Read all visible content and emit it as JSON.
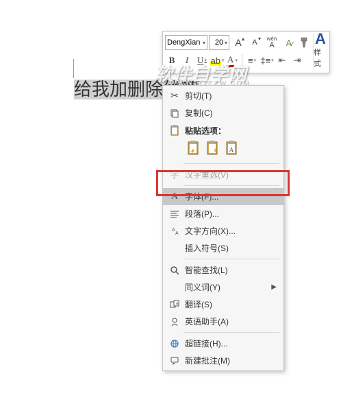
{
  "document": {
    "selected_text": "给我加删除线吧"
  },
  "toolbar": {
    "font_name": "DengXian",
    "font_size": "20",
    "style_label": "样式"
  },
  "watermark": {
    "main": "软件自学网",
    "sub": "WWW.RJZXW.COM"
  },
  "menu": {
    "cut": "剪切(T)",
    "copy": "复制(C)",
    "paste_options": "粘贴选项：",
    "han_reselect": "汉字重选(V)",
    "font": "字体(F)...",
    "paragraph": "段落(P)...",
    "text_direction": "文字方向(X)...",
    "insert_symbol": "插入符号(S)",
    "smart_lookup": "智能查找(L)",
    "synonyms": "同义词(Y)",
    "translate": "翻译(S)",
    "english_assistant": "英语助手(A)",
    "hyperlink": "超链接(H)...",
    "new_comment": "新建批注(M)"
  }
}
